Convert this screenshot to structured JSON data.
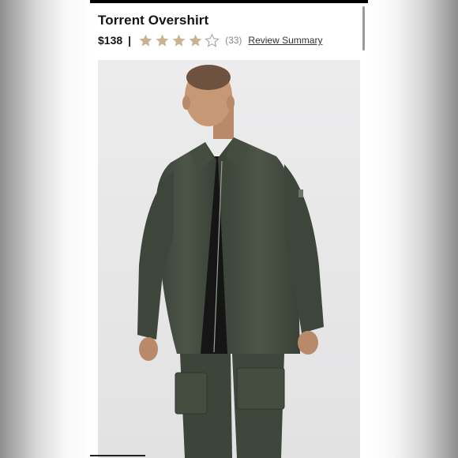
{
  "product": {
    "title": "Torrent Overshirt",
    "price": "$138",
    "separator": "|",
    "rating": 4,
    "rating_max": 5,
    "review_count": "(33)",
    "review_summary_label": "Review Summary",
    "image_icon": "product-photo"
  },
  "colors": {
    "star_filled": "#c9b28f",
    "star_empty": "#9e9e9e",
    "jacket": "#4a5246",
    "tee": "#151515"
  }
}
